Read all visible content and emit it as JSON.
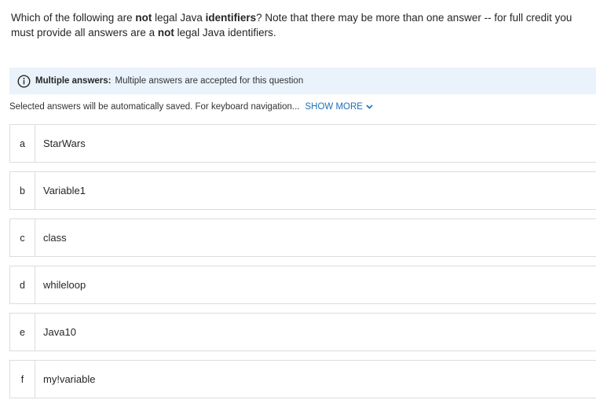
{
  "question": {
    "p1": "Which of the following are ",
    "b1": "not",
    "p2": " legal Java ",
    "b2": "identifiers",
    "p3": "? Note that there may be more than one answer -- for full credit you must provide all answers are a ",
    "b3": "not",
    "p4": " legal Java identifiers."
  },
  "info": {
    "icon": "info-icon",
    "title": "Multiple answers:",
    "text": "Multiple answers are accepted for this question",
    "accent": "#1c6fb8",
    "background": "#eaf3fb"
  },
  "saved": {
    "text": "Selected answers will be automatically saved. For keyboard navigation...",
    "show_more": "SHOW MORE"
  },
  "options": [
    {
      "letter": "a",
      "text": "StarWars"
    },
    {
      "letter": "b",
      "text": "Variable1"
    },
    {
      "letter": "c",
      "text": "class"
    },
    {
      "letter": "d",
      "text": "whileloop"
    },
    {
      "letter": "e",
      "text": "Java10"
    },
    {
      "letter": "f",
      "text": "my!variable"
    }
  ]
}
